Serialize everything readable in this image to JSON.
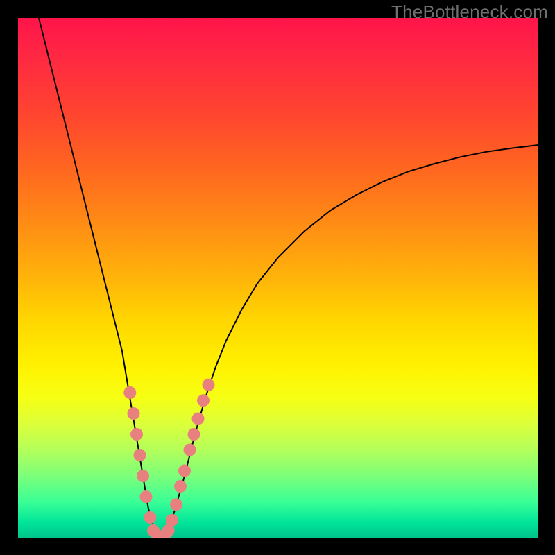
{
  "watermark": "TheBottleneck.com",
  "colors": {
    "background_black": "#000000",
    "dot_fill": "#e98080",
    "curve_stroke": "#000000",
    "gradient_stops": [
      "#ff144a",
      "#ff2a42",
      "#ff4330",
      "#ff6a1e",
      "#ff8e14",
      "#ffb40a",
      "#ffd600",
      "#fff200",
      "#f6ff14",
      "#dcff3a",
      "#b4ff5a",
      "#7cff7a",
      "#3aff96",
      "#00e59a",
      "#00c28a"
    ]
  },
  "chart_data": {
    "type": "line",
    "title": "",
    "xlabel": "",
    "ylabel": "",
    "xlim": [
      0,
      100
    ],
    "ylim": [
      0,
      100
    ],
    "legend": false,
    "grid": false,
    "series": [
      {
        "name": "bottleneck-curve",
        "x": [
          4,
          6,
          8,
          10,
          12,
          14,
          16,
          18,
          20,
          22,
          23,
          24,
          25,
          26,
          27,
          28,
          29,
          30,
          32,
          34,
          36,
          38,
          40,
          43,
          46,
          50,
          55,
          60,
          65,
          70,
          75,
          80,
          85,
          90,
          95,
          100
        ],
        "y": [
          100,
          92,
          84,
          76,
          68,
          60,
          52,
          44,
          36,
          24,
          18,
          12,
          6,
          2,
          0,
          0,
          2,
          5,
          12,
          20,
          27,
          33,
          38,
          44,
          49,
          54,
          59,
          63,
          66,
          68.5,
          70.5,
          72,
          73.3,
          74.3,
          75,
          75.6
        ]
      }
    ],
    "markers": [
      {
        "name": "sample-points",
        "points": [
          {
            "x": 21.5,
            "y": 28
          },
          {
            "x": 22.2,
            "y": 24
          },
          {
            "x": 22.8,
            "y": 20
          },
          {
            "x": 23.4,
            "y": 16
          },
          {
            "x": 24.0,
            "y": 12
          },
          {
            "x": 24.6,
            "y": 8
          },
          {
            "x": 25.4,
            "y": 4
          },
          {
            "x": 26.0,
            "y": 1.5
          },
          {
            "x": 26.8,
            "y": 0.5
          },
          {
            "x": 27.5,
            "y": 0.3
          },
          {
            "x": 28.2,
            "y": 0.6
          },
          {
            "x": 28.9,
            "y": 1.5
          },
          {
            "x": 29.6,
            "y": 3.5
          },
          {
            "x": 30.4,
            "y": 6.5
          },
          {
            "x": 31.2,
            "y": 10
          },
          {
            "x": 32.0,
            "y": 13
          },
          {
            "x": 33.0,
            "y": 17
          },
          {
            "x": 33.8,
            "y": 20
          },
          {
            "x": 34.6,
            "y": 23
          },
          {
            "x": 35.6,
            "y": 26.5
          },
          {
            "x": 36.6,
            "y": 29.5
          }
        ]
      }
    ],
    "annotations": []
  }
}
